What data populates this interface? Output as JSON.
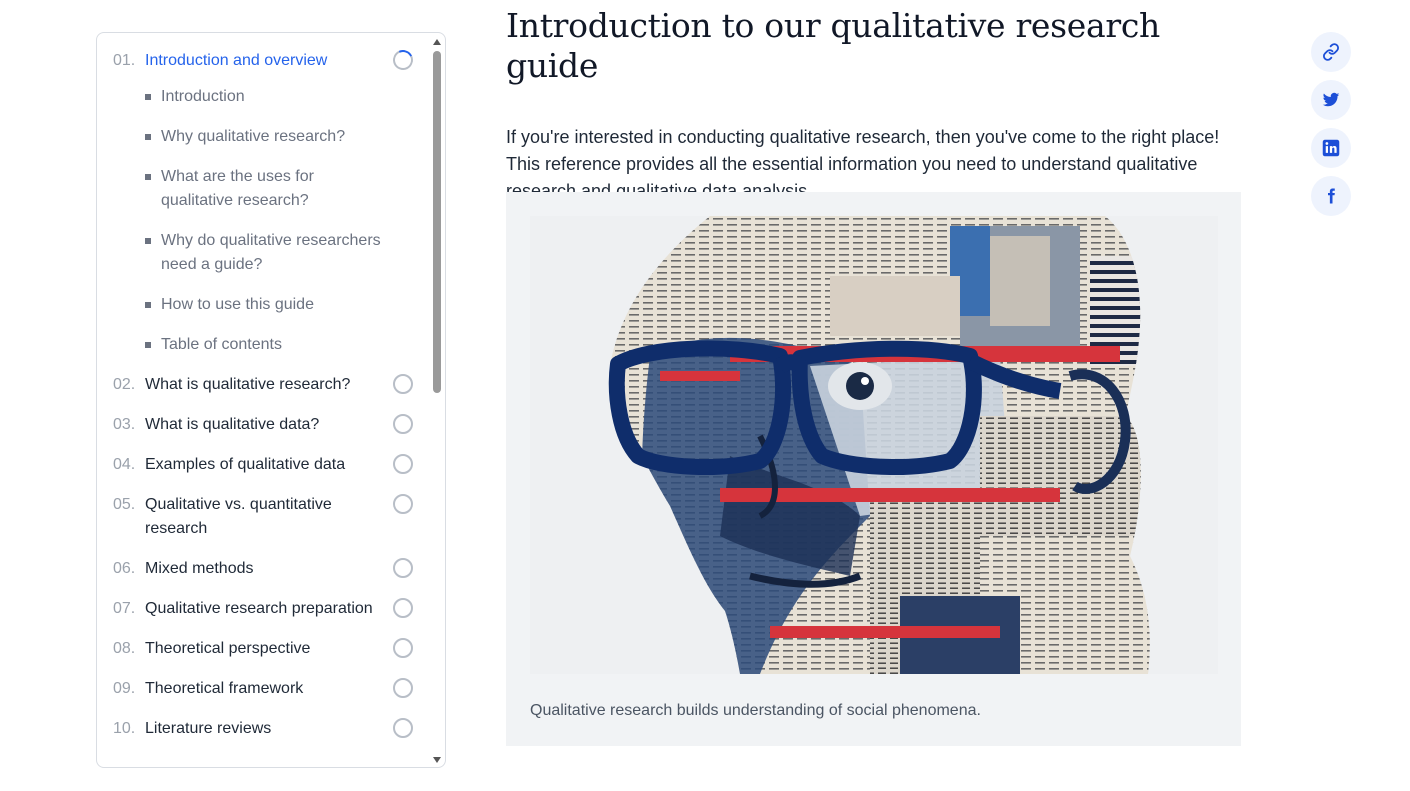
{
  "toc": {
    "chapters": [
      {
        "num": "01.",
        "title": "Introduction and overview",
        "active": true,
        "sections": [
          "Introduction",
          "Why qualitative research?",
          "What are the uses for qualitative research?",
          "Why do qualitative researchers need a guide?",
          "How to use this guide",
          "Table of contents"
        ]
      },
      {
        "num": "02.",
        "title": "What is qualitative research?"
      },
      {
        "num": "03.",
        "title": "What is qualitative data?"
      },
      {
        "num": "04.",
        "title": "Examples of qualitative data"
      },
      {
        "num": "05.",
        "title": "Qualitative vs. quantitative research"
      },
      {
        "num": "06.",
        "title": "Mixed methods"
      },
      {
        "num": "07.",
        "title": "Qualitative research preparation"
      },
      {
        "num": "08.",
        "title": "Theoretical perspective"
      },
      {
        "num": "09.",
        "title": "Theoretical framework"
      },
      {
        "num": "10.",
        "title": "Literature reviews"
      }
    ]
  },
  "article": {
    "title": "Introduction to our qualitative research guide",
    "intro": "If you're interested in conducting qualitative research, then you've come to the right place! This reference provides all the essential information you need to understand qualitative research and qualitative data analysis.",
    "figure_caption": "Qualitative research builds understanding of social phenomena."
  },
  "share": [
    {
      "icon": "link-icon"
    },
    {
      "icon": "twitter-icon"
    },
    {
      "icon": "linkedin-icon"
    },
    {
      "icon": "facebook-icon"
    }
  ],
  "colors": {
    "accent": "#2563eb",
    "icon_blue": "#1d4fd7",
    "share_bg": "#eef3fd",
    "figure_bg": "#f1f3f5"
  }
}
